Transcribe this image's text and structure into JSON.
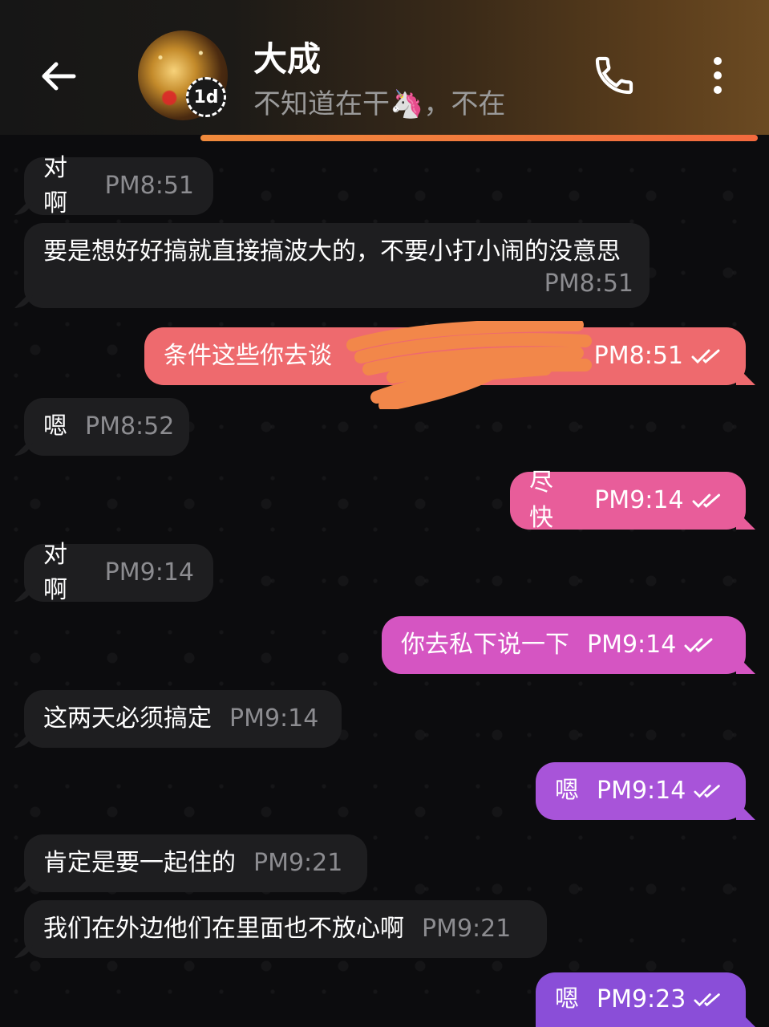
{
  "header": {
    "contact_name": "大成",
    "status_text": "不知道在干🦄，不在",
    "story_badge": "1d",
    "accent_color": "#f07a3c"
  },
  "icons": {
    "back": "back-arrow-icon",
    "call": "phone-icon",
    "more": "more-vertical-icon",
    "read": "double-check-icon"
  },
  "colors": {
    "incoming_bubble": "#1e1e20",
    "outgoing_1": "#ee6a6e",
    "outgoing_2": "#e85d9a",
    "outgoing_3": "#d555c2",
    "outgoing_4": "#a854d9",
    "outgoing_5": "#8a4ed8"
  },
  "messages": [
    {
      "dir": "in",
      "text": "对啊",
      "time": "PM8:51"
    },
    {
      "dir": "in",
      "text": "要是想好好搞就直接搞波大的，不要小打小闹的没意思",
      "time": "PM8:51"
    },
    {
      "dir": "out",
      "text": "条件这些你去谈",
      "time": "PM8:51",
      "redacted": true
    },
    {
      "dir": "in",
      "text": "嗯",
      "time": "PM8:52"
    },
    {
      "dir": "out",
      "text": "尽快",
      "time": "PM9:14"
    },
    {
      "dir": "in",
      "text": "对啊",
      "time": "PM9:14"
    },
    {
      "dir": "out",
      "text": "你去私下说一下",
      "time": "PM9:14"
    },
    {
      "dir": "in",
      "text": "这两天必须搞定",
      "time": "PM9:14"
    },
    {
      "dir": "out",
      "text": "嗯",
      "time": "PM9:14"
    },
    {
      "dir": "in",
      "text": "肯定是要一起住的",
      "time": "PM9:21"
    },
    {
      "dir": "in",
      "text": "我们在外边他们在里面也不放心啊",
      "time": "PM9:21"
    },
    {
      "dir": "out",
      "text": "嗯",
      "time": "PM9:23"
    }
  ]
}
